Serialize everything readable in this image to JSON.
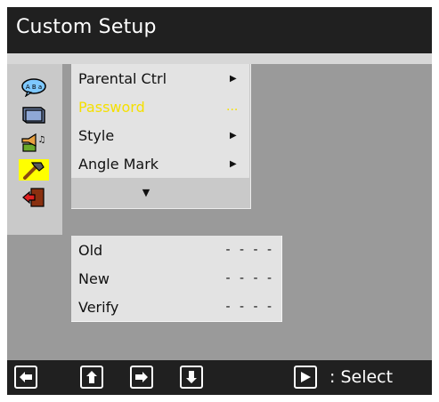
{
  "title": "Custom Setup",
  "side_icons": [
    {
      "name": "language-icon",
      "badge": "A B a",
      "selected": false
    },
    {
      "name": "tv-display-icon",
      "selected": false
    },
    {
      "name": "audio-speaker-icon",
      "selected": false
    },
    {
      "name": "hammer-preference-icon",
      "selected": true
    },
    {
      "name": "exit-door-icon",
      "selected": false
    }
  ],
  "submenu": {
    "items": [
      {
        "label": "Parental Ctrl",
        "indicator": "▶"
      },
      {
        "label": "Password",
        "indicator": "...",
        "active": true
      },
      {
        "label": "Style",
        "indicator": "▶"
      },
      {
        "label": "Angle Mark",
        "indicator": "▶"
      }
    ],
    "more_indicator": "▼"
  },
  "password_panel": {
    "rows": [
      {
        "label": "Old",
        "value": "- - - -"
      },
      {
        "label": "New",
        "value": "- - - -"
      },
      {
        "label": "Verify",
        "value": "- - - -"
      }
    ]
  },
  "nav_bar": {
    "buttons": [
      "left-arrow-icon",
      "up-arrow-icon",
      "right-arrow-icon",
      "down-arrow-icon",
      "play-icon"
    ],
    "select_label": ": Select"
  },
  "colors": {
    "highlight": "#ffff00",
    "active_text": "#f5e000",
    "bar_background": "#202020",
    "panel_background": "#9a9a9a"
  }
}
